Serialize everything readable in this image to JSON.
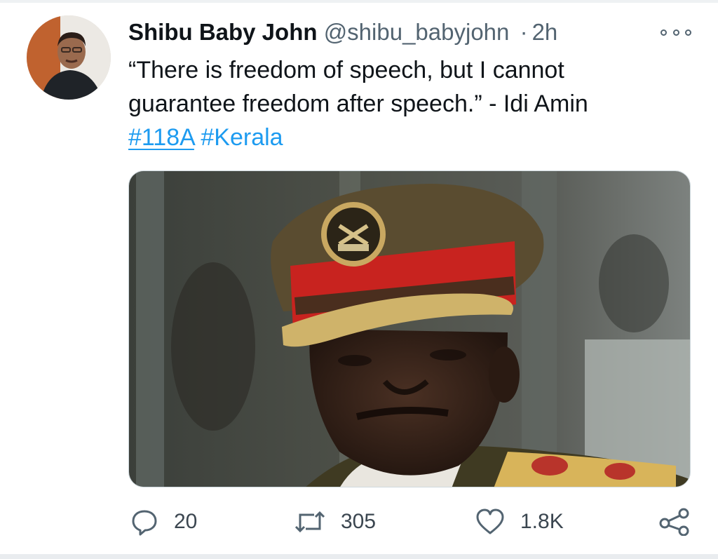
{
  "tweet": {
    "display_name": "Shibu Baby John",
    "handle": "@shibu_babyjohn",
    "separator": "·",
    "time": "2h",
    "text_line1": "“There is freedom of speech, but I cannot",
    "text_line2": "guarantee freedom after speech.” - Idi Amin",
    "hashtag1": "#118A",
    "hashtag2": "#Kerala"
  },
  "actions": {
    "reply_count": "20",
    "retweet_count": "305",
    "like_count": "1.8K"
  },
  "icons": {
    "more": "more-options-icon",
    "reply": "reply-icon",
    "retweet": "retweet-icon",
    "like": "like-heart-icon",
    "share": "share-icon"
  },
  "colors": {
    "hashtag": "#1d9bf0",
    "secondary_text": "#536471",
    "primary_text": "#0f1419",
    "cap_band_red": "#c8231f"
  }
}
